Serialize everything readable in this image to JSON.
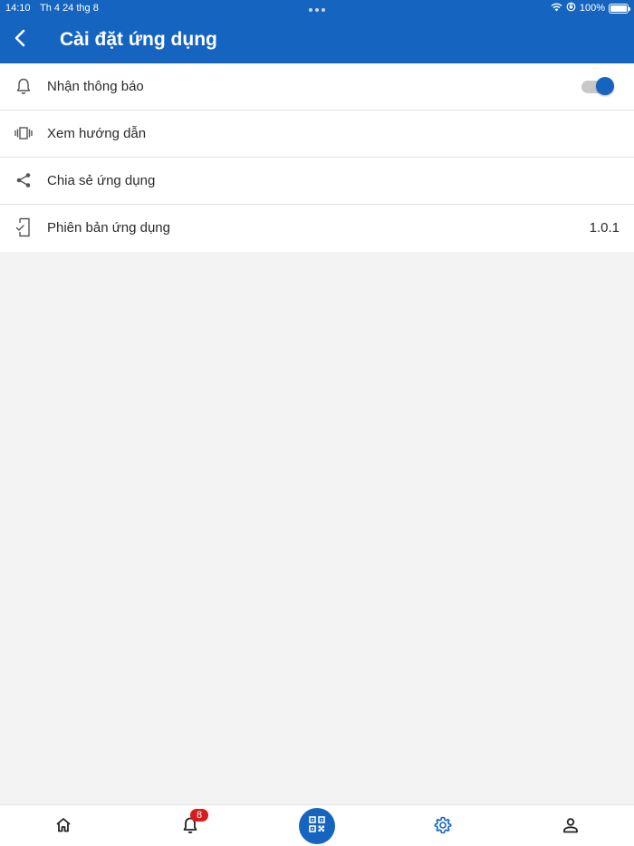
{
  "status_bar": {
    "time": "14:10",
    "date": "Th 4 24 thg 8",
    "battery": "100%"
  },
  "header": {
    "title": "Cài đặt ứng dụng",
    "back_icon": "chevron-left-icon"
  },
  "settings": {
    "items": [
      {
        "icon": "bell-icon",
        "label": "Nhận thông báo",
        "control": "toggle",
        "enabled": true
      },
      {
        "icon": "carousel-icon",
        "label": "Xem hướng dẫn"
      },
      {
        "icon": "share-icon",
        "label": "Chia sẻ ứng dụng"
      },
      {
        "icon": "phone-check-icon",
        "label": "Phiên bản ứng dụng",
        "value": "1.0.1"
      }
    ]
  },
  "bottom_nav": {
    "items": [
      {
        "icon": "home-icon"
      },
      {
        "icon": "bell-icon",
        "badge": "8"
      },
      {
        "icon": "qr-code-icon"
      },
      {
        "icon": "gear-icon",
        "active": true
      },
      {
        "icon": "person-icon"
      }
    ]
  },
  "colors": {
    "primary": "#1565c0",
    "background": "#f3f3f3",
    "badge": "#d81b1b"
  }
}
